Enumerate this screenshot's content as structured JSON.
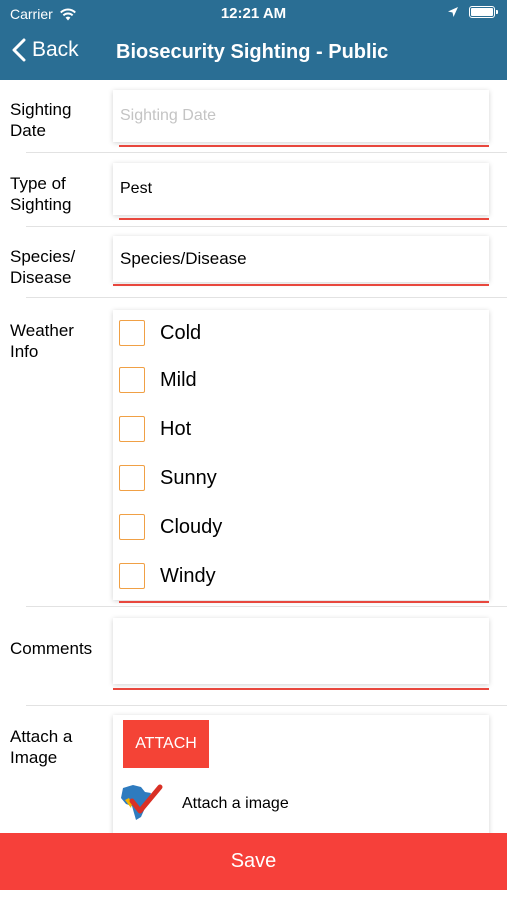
{
  "status_bar": {
    "carrier": "Carrier",
    "time": "12:21 AM"
  },
  "nav": {
    "back_label": "Back",
    "title": "Biosecurity Sighting - Public"
  },
  "form": {
    "sighting_date": {
      "label": "Sighting Date",
      "value": "",
      "placeholder": "Sighting Date"
    },
    "type_of_sighting": {
      "label": "Type of Sighting",
      "value": "Pest"
    },
    "species_disease": {
      "label": "Species/ Disease",
      "value": "Species/Disease"
    },
    "weather": {
      "label": "Weather Info",
      "options": [
        {
          "label": "Cold",
          "checked": false
        },
        {
          "label": "Mild",
          "checked": false
        },
        {
          "label": "Hot",
          "checked": false
        },
        {
          "label": "Sunny",
          "checked": false
        },
        {
          "label": "Cloudy",
          "checked": false
        },
        {
          "label": "Windy",
          "checked": false
        }
      ]
    },
    "comments": {
      "label": "Comments",
      "value": ""
    },
    "attach": {
      "label": "Attach a Image",
      "button_label": "ATTACH",
      "image_label": "Attach a image"
    }
  },
  "save_label": "Save",
  "colors": {
    "header": "#2a6e94",
    "accent": "#f6403a",
    "checkbox_border": "#f0a045"
  }
}
